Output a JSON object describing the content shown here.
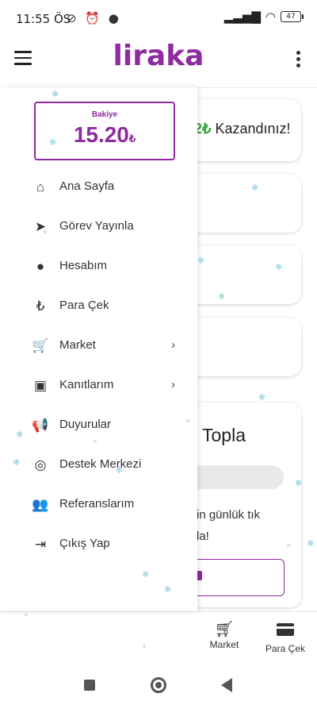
{
  "status_bar": {
    "time": "11:55 ÖS",
    "notification_icons": "⊘ ⏰ ●",
    "battery": "47"
  },
  "app": {
    "logo": "liraka"
  },
  "drawer": {
    "balance_label": "Bakiye",
    "balance_value": "15.20",
    "currency_symbol": "₺",
    "items": [
      {
        "icon": "home-icon",
        "glyph": "⌂",
        "label": "Ana Sayfa",
        "chevron": ""
      },
      {
        "icon": "paper-plane-icon",
        "glyph": "➤",
        "label": "Görev Yayınla",
        "chevron": ""
      },
      {
        "icon": "user-circle-icon",
        "glyph": "●",
        "label": "Hesabım",
        "chevron": ""
      },
      {
        "icon": "lira-icon",
        "glyph": "₺",
        "label": "Para Çek",
        "chevron": ""
      },
      {
        "icon": "cart-icon",
        "glyph": "🛒",
        "label": "Market",
        "chevron": "›"
      },
      {
        "icon": "image-icon",
        "glyph": "▣",
        "label": "Kanıtlarım",
        "chevron": "›"
      },
      {
        "icon": "megaphone-icon",
        "glyph": "📢",
        "label": "Duyurular",
        "chevron": ""
      },
      {
        "icon": "lifebuoy-icon",
        "glyph": "◎",
        "label": "Destek Merkezi",
        "chevron": ""
      },
      {
        "icon": "users-icon",
        "glyph": "👥",
        "label": "Referanslarım",
        "chevron": ""
      },
      {
        "icon": "sign-out-icon",
        "glyph": "⇥",
        "label": "Çıkış Yap",
        "chevron": ""
      }
    ]
  },
  "background": {
    "win_prefix": "2",
    "win_currency": "₺",
    "win_text": "Kazandınız!",
    "topla_title": "Topla",
    "daily_text": "in günlük tık",
    "daily_text2": "la!"
  },
  "bottom_nav": {
    "market_label": "Market",
    "withdraw_label": "Para Çek"
  },
  "colors": {
    "brand": "#8e2ba0",
    "accent_green": "#3aa33a"
  }
}
